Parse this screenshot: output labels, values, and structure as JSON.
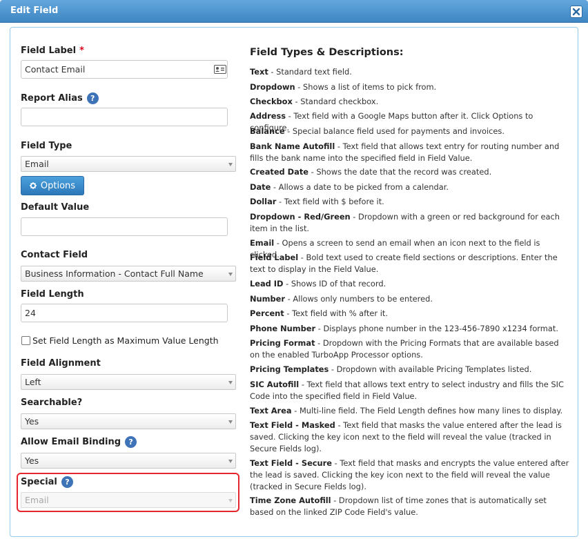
{
  "dialog": {
    "title": "Edit Field"
  },
  "form": {
    "field_label": {
      "label": "Field Label",
      "required_mark": "*",
      "value": "Contact Email"
    },
    "report_alias": {
      "label": "Report Alias",
      "value": ""
    },
    "field_type": {
      "label": "Field Type",
      "value": "Email",
      "options_button": "Options"
    },
    "default_value": {
      "label": "Default Value",
      "value": ""
    },
    "contact_field": {
      "label": "Contact Field",
      "value": "Business Information - Contact Full Name"
    },
    "field_length": {
      "label": "Field Length",
      "value": "24"
    },
    "set_max_length": {
      "label": "Set Field Length as Maximum Value Length",
      "checked": false
    },
    "field_alignment": {
      "label": "Field Alignment",
      "value": "Left"
    },
    "searchable": {
      "label": "Searchable?",
      "value": "Yes"
    },
    "allow_email_binding": {
      "label": "Allow Email Binding",
      "value": "Yes"
    },
    "special": {
      "label": "Special",
      "value": "Email"
    },
    "help_glyph": "?"
  },
  "types": {
    "heading": "Field Types & Descriptions:",
    "items": [
      {
        "name": "Text",
        "desc": " - Standard text field."
      },
      {
        "name": "Dropdown",
        "desc": " - Shows a list of items to pick from."
      },
      {
        "name": "Checkbox",
        "desc": " - Standard checkbox."
      },
      {
        "name": "Address",
        "desc": " - Text field with a Google Maps button after it. Click Options to configure."
      },
      {
        "name": "Balance",
        "desc": " - Special balance field used for payments and invoices."
      },
      {
        "name": "Bank Name Autofill",
        "desc": " - Text field that allows text entry for routing number and fills the bank name into the specified field in Field Value."
      },
      {
        "name": "Created Date",
        "desc": " - Shows the date that the record was created."
      },
      {
        "name": "Date",
        "desc": " - Allows a date to be picked from a calendar."
      },
      {
        "name": "Dollar",
        "desc": " - Text field with $ before it."
      },
      {
        "name": "Dropdown - Red/Green",
        "desc": " - Dropdown with a green or red background for each item in the list."
      },
      {
        "name": "Email",
        "desc": " - Opens a screen to send an email when an icon next to the field is clicked."
      },
      {
        "name": "Field Label",
        "desc": " - Bold text used to create field sections or descriptions. Enter the text to display in the Field Value."
      },
      {
        "name": "Lead ID",
        "desc": " - Shows ID of that record."
      },
      {
        "name": "Number",
        "desc": " - Allows only numbers to be entered."
      },
      {
        "name": "Percent",
        "desc": " - Text field with % after it."
      },
      {
        "name": "Phone Number",
        "desc": " - Displays phone number in the 123-456-7890 x1234 format."
      },
      {
        "name": "Pricing Format",
        "desc": " - Dropdown with the Pricing Formats that are available based on the enabled TurboApp Processor options."
      },
      {
        "name": "Pricing Templates",
        "desc": " - Dropdown with available Pricing Templates listed."
      },
      {
        "name": "SIC Autofill",
        "desc": " - Text field that allows text entry to select industry and fills the SIC Code into the specified field in Field Value."
      },
      {
        "name": "Text Area",
        "desc": " - Multi-line field. The Field Length defines how many lines to display."
      },
      {
        "name": "Text Field - Masked",
        "desc": " - Text field that masks the value entered after the lead is saved. Clicking the key icon next to the field will reveal the value (tracked in Secure Fields log)."
      },
      {
        "name": "Text Field - Secure",
        "desc": " - Text field that masks and encrypts the value entered after the lead is saved. Clicking the key icon next to the field will reveal the value (tracked in Secure Fields log)."
      },
      {
        "name": "Time Zone Autofill",
        "desc": " - Dropdown list of time zones that is automatically set based on the linked ZIP Code Field's value."
      }
    ]
  }
}
